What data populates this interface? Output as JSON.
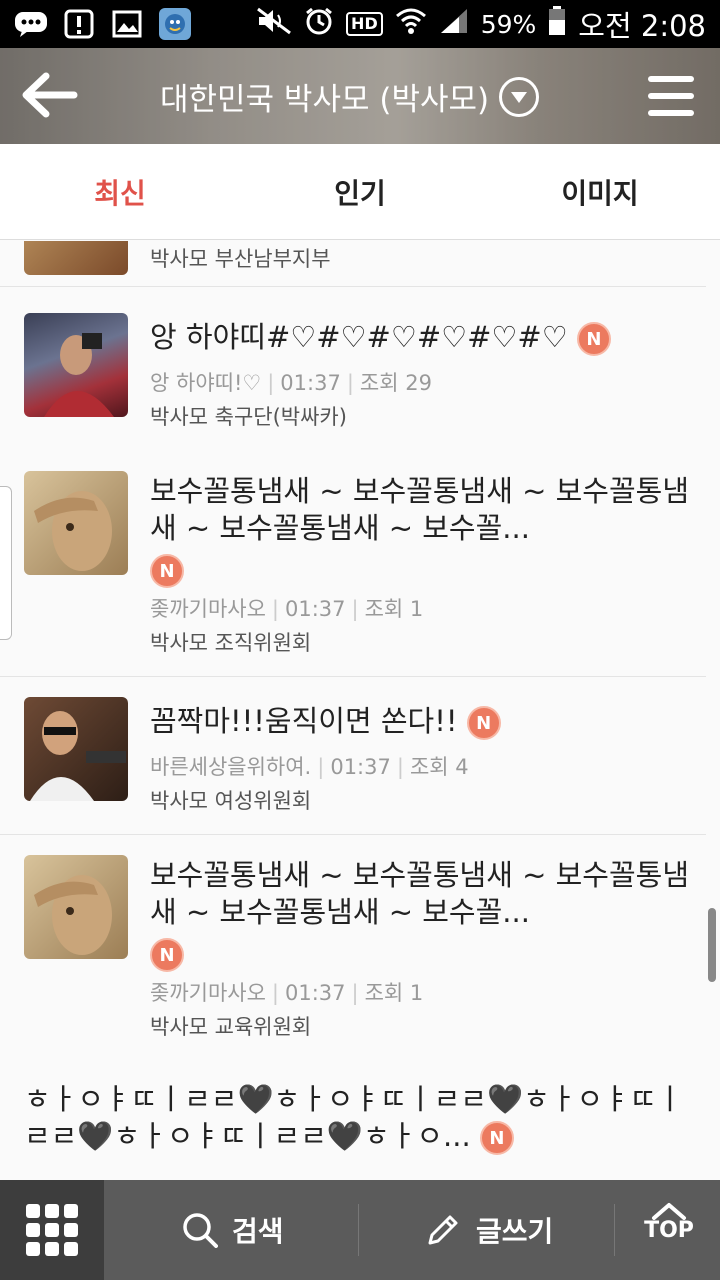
{
  "status_bar": {
    "battery": "59%",
    "time": "오전 2:08",
    "hd_label": "HD",
    "icons": [
      "chat-icon",
      "alert-icon",
      "image-icon",
      "app-avatar-icon",
      "mute-icon",
      "alarm-icon",
      "hd-icon",
      "wifi-icon",
      "signal-icon",
      "battery-icon"
    ]
  },
  "header": {
    "title": "대한민국 박사모 (박사모)",
    "back_icon": "arrow-left-icon",
    "dropdown_icon": "chevron-down-icon",
    "menu_icon": "hamburger-icon"
  },
  "tabs": [
    {
      "label": "최신",
      "active": true
    },
    {
      "label": "인기",
      "active": false
    },
    {
      "label": "이미지",
      "active": false
    }
  ],
  "posts": [
    {
      "title": "",
      "author": "",
      "time": "",
      "views": "",
      "club": "박사모 부산남부지부",
      "new": false
    },
    {
      "title": "앙 하야띠#♡#♡#♡#♡#♡#♡",
      "author": "앙 하야띠!♡",
      "time": "01:37",
      "views": "조회 29",
      "club": "박사모 축구단(박싸카)",
      "new": true
    },
    {
      "title": "보수꼴통냄새 ~ 보수꼴통냄새 ~ 보수꼴통냄새 ~ 보수꼴통냄새 ~ 보수꼴...",
      "author": "좆까기마사오",
      "time": "01:37",
      "views": "조회 1",
      "club": "박사모 조직위원회",
      "new": true
    },
    {
      "title": "꼼짝마!!!움직이면 쏜다!!",
      "author": "바른세상을위하여.",
      "time": "01:37",
      "views": "조회 4",
      "club": "박사모 여성위원회",
      "new": true
    },
    {
      "title": "보수꼴통냄새 ~ 보수꼴통냄새 ~ 보수꼴통냄새 ~ 보수꼴통냄새 ~ 보수꼴...",
      "author": "좆까기마사오",
      "time": "01:37",
      "views": "조회 1",
      "club": "박사모 교육위원회",
      "new": true
    },
    {
      "title": "ㅎㅏㅇㅑㄸㅣㄹㄹ🖤ㅎㅏㅇㅑㄸㅣㄹㄹ🖤ㅎㅏㅇㅑㄸㅣㄹㄹ🖤ㅎㅏㅇㅑㄸㅣㄹㄹ🖤ㅎㅏㅇ...",
      "author": "",
      "time": "",
      "views": "",
      "club": "",
      "new": true
    }
  ],
  "new_badge": "N",
  "bottom_bar": {
    "apps_icon": "grid-icon",
    "search_label": "검색",
    "search_icon": "search-icon",
    "write_label": "글쓰기",
    "write_icon": "pencil-icon",
    "top_label": "TOP",
    "top_icon": "chevron-up-icon"
  },
  "colors": {
    "accent": "#e0524a",
    "badge": "#ec7a5f",
    "bottom_bar": "#5b5b5b"
  }
}
